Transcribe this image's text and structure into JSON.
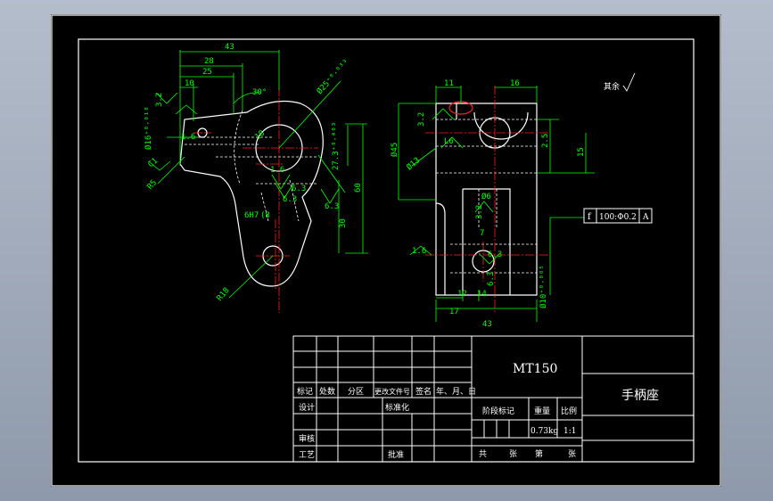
{
  "drawing": {
    "front_view_dims": {
      "d43": "43",
      "d28": "28",
      "d25": "25",
      "d10": "10",
      "angle30": "30°",
      "r25": "Ø25⁺⁰·⁰³³",
      "d18": "18",
      "d27": "27.3⁺⁰·⁴⁰³",
      "d60": "60",
      "d30": "30",
      "r18": "R18",
      "d6h7": "6H7",
      "dim8": "(8",
      "dim_phi16": "Ø16⁺⁰·⁰¹⁸",
      "dim16": "1.6",
      "dim_r5": "R5",
      "dim_c": "C1",
      "ra32": "3.2",
      "ra63a": "6.3",
      "ra63b": "6.3",
      "ra16": "1.6",
      "ra63c": "6.3"
    },
    "side_view_dims": {
      "d11": "11",
      "d16": "16",
      "d25v": "2.5",
      "d15": "15",
      "d45": "Ø45",
      "d13": "Ø13",
      "d6": "Ø6",
      "d7": "7",
      "d12": "12",
      "d14": "14",
      "d17": "17",
      "d43b": "43",
      "d10v": "Ø10⁺⁰·⁰⁰⁵",
      "ra32b": "3.2",
      "ra16b": "L6",
      "ra16c": "1.6",
      "ra63d": "6.3",
      "ra63e": "6.3",
      "ra32c": "3.2"
    },
    "tolerance_frame": {
      "symbol": "f",
      "value": "100:Φ0.2",
      "datum": "A"
    },
    "surface_note": "其余"
  },
  "title_block": {
    "part_code": "MT150",
    "part_name": "手柄座",
    "headers": {
      "mark": "标记",
      "count": "处数",
      "zone": "分区",
      "change_doc": "更改文件号",
      "sign": "签名",
      "date": "年、月、日"
    },
    "rows": {
      "design": "设计",
      "standard": "标准化",
      "review": "审核",
      "process": "工艺",
      "approve": "批准"
    },
    "stage_label": "阶段标记",
    "weight_label": "重量",
    "scale_label": "比例",
    "weight": "0.73kg",
    "scale": "1:1",
    "sheets": {
      "total": "共",
      "zhang1": "张",
      "nth": "第",
      "zhang2": "张"
    }
  }
}
